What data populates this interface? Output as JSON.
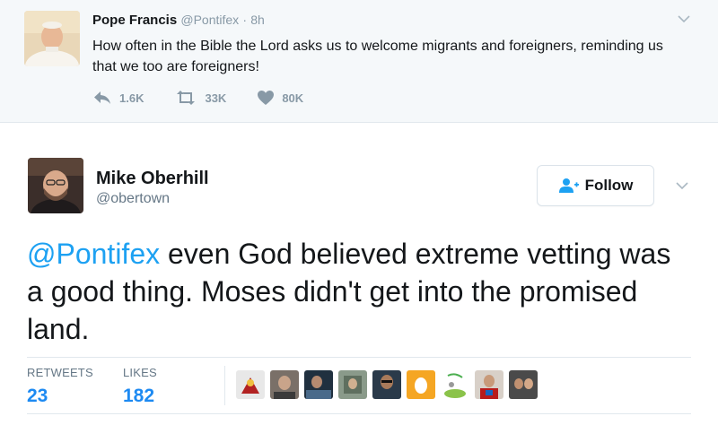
{
  "parent_tweet": {
    "author_name": "Pope Francis",
    "author_handle": "@Pontifex",
    "separator": "·",
    "time": "8h",
    "text": "How often in the Bible the Lord asks us to welcome migrants and foreigners, reminding us that we too are foreigners!",
    "actions": {
      "reply_count": "1.6K",
      "retweet_count": "33K",
      "like_count": "80K"
    }
  },
  "main_tweet": {
    "author_name": "Mike Oberhill",
    "author_handle": "@obertown",
    "follow_label": "Follow",
    "mention": "@Pontifex",
    "text_rest": " even God believed extreme vetting was a good thing. Moses didn't get into the promised land.",
    "stats": {
      "retweets_label": "RETWEETS",
      "retweets_value": "23",
      "likes_label": "LIKES",
      "likes_value": "182"
    }
  },
  "colors": {
    "accent": "#1da1f2",
    "stat_value": "#1d8af2",
    "muted": "#8899a6",
    "parent_background": "#f5f8fa"
  },
  "icons": {
    "reply": "reply-icon",
    "retweet": "retweet-icon",
    "like": "heart-icon",
    "caret": "chevron-down-icon",
    "follow": "add-user-icon"
  },
  "liker_count_shown": 9
}
